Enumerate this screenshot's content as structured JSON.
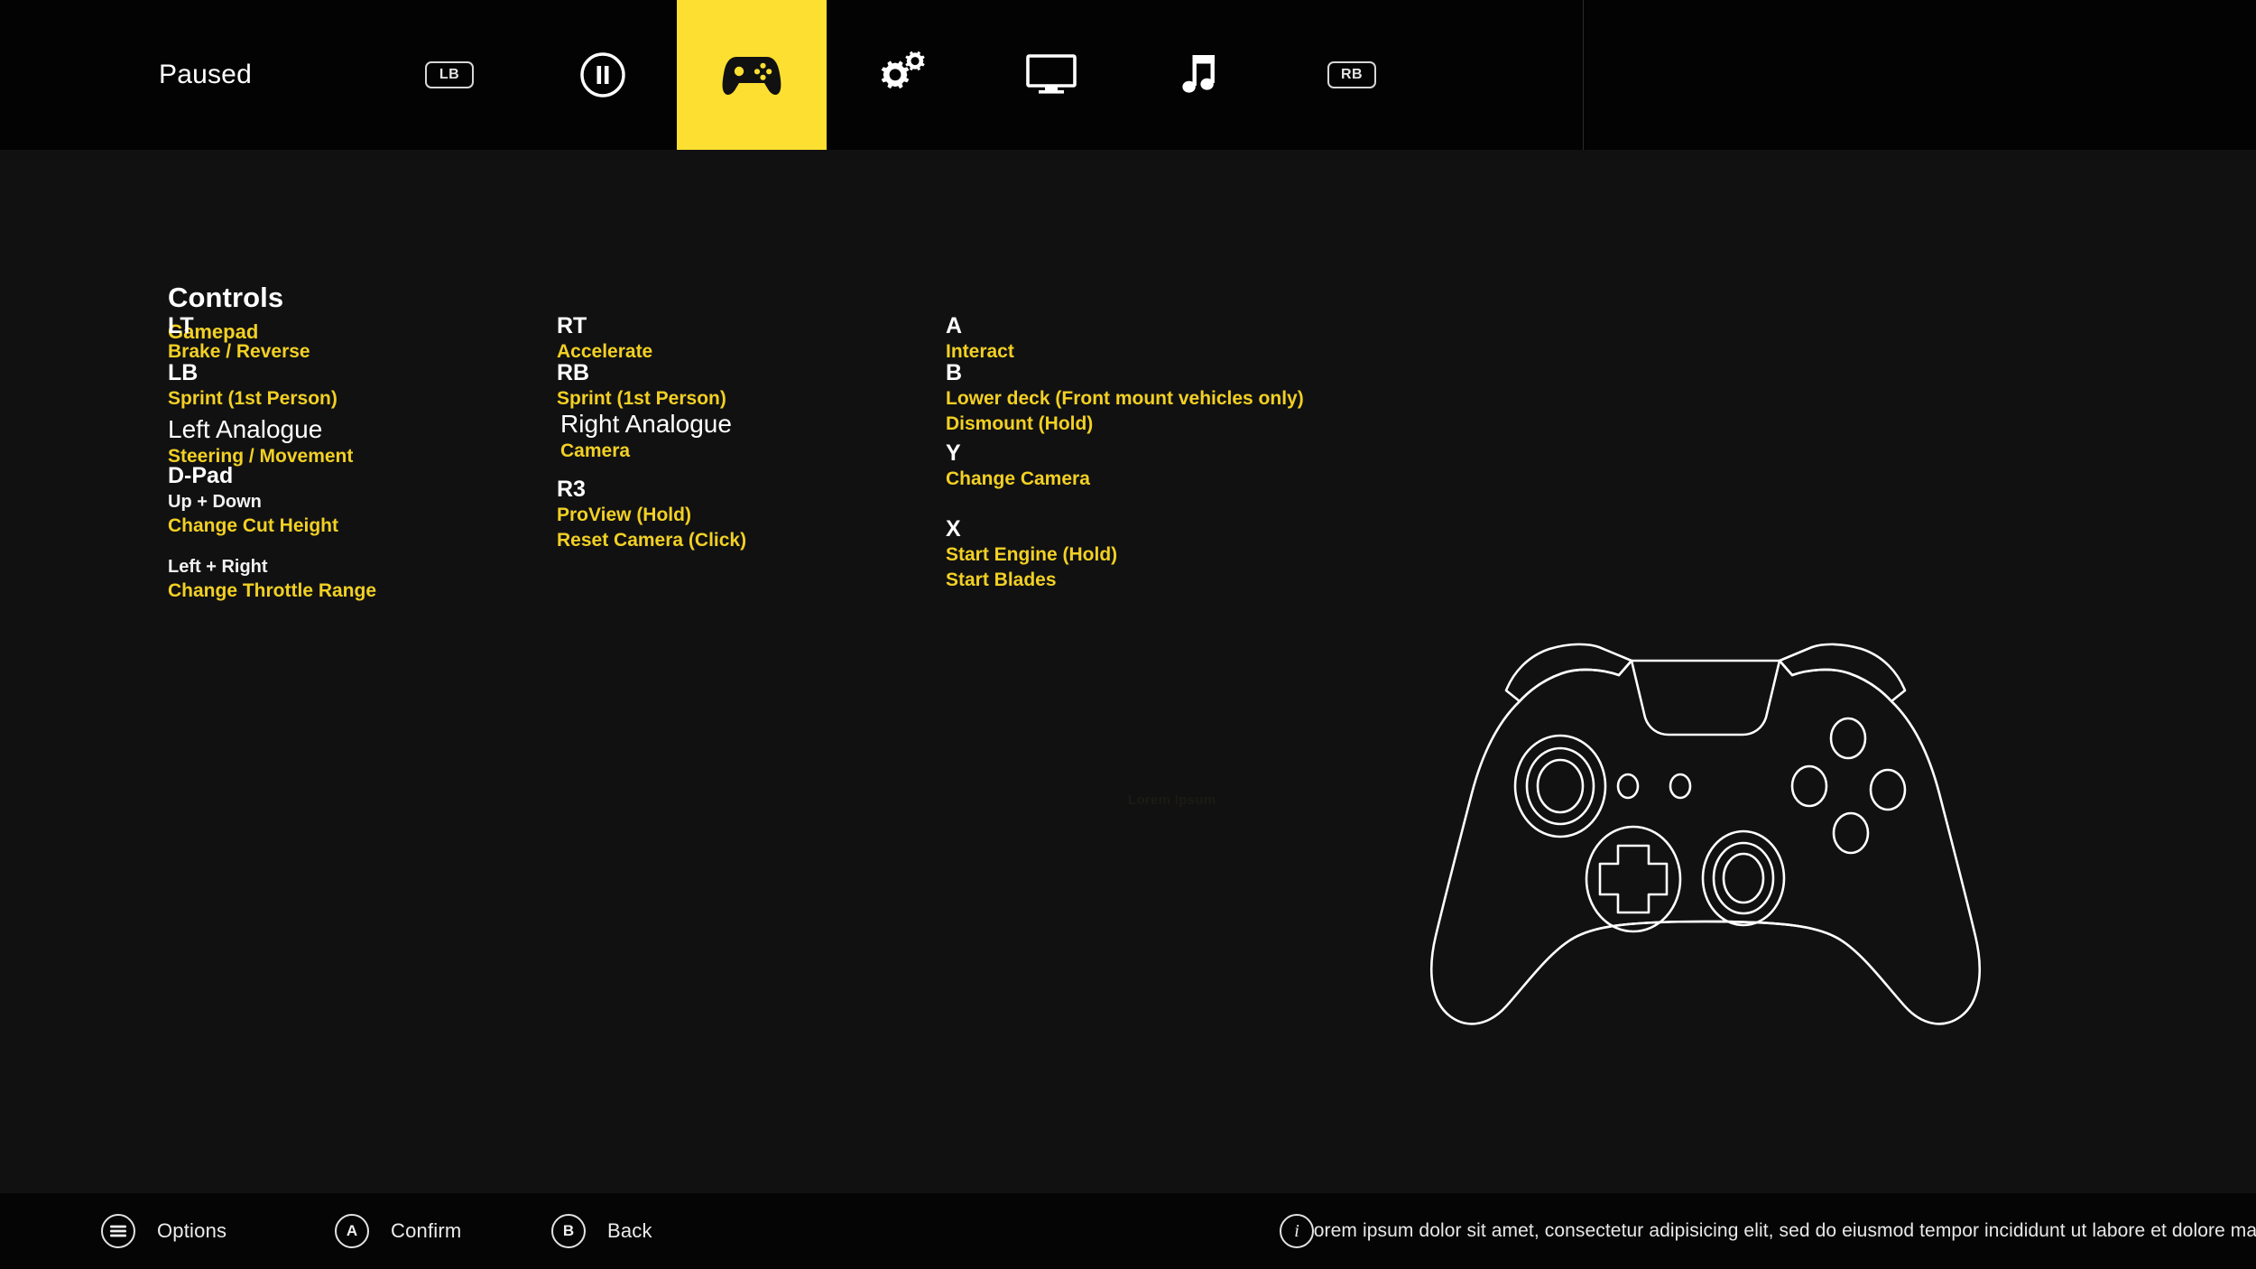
{
  "header": {
    "status_label": "Paused",
    "left_bumper_chip": "LB",
    "right_bumper_chip": "RB",
    "active_tab_color": "#FCDF31",
    "tabs": [
      {
        "id": "pause",
        "icon": "pause-circle-icon",
        "active": false
      },
      {
        "id": "controls",
        "icon": "gamepad-icon",
        "active": true
      },
      {
        "id": "settings",
        "icon": "gears-icon",
        "active": false
      },
      {
        "id": "display",
        "icon": "monitor-icon",
        "active": false
      },
      {
        "id": "audio",
        "icon": "music-note-icon",
        "active": false
      }
    ]
  },
  "main": {
    "title": "Controls",
    "subtitle": "Gamepad",
    "accent_color": "#F2D024",
    "watermark": "Lorem Ipsum",
    "columns": [
      {
        "bindings": [
          {
            "button": "LT",
            "big": false,
            "actions": [
              "Brake / Reverse"
            ]
          },
          {
            "button": "LB",
            "big": false,
            "actions": [
              "Sprint (1st Person)"
            ]
          },
          {
            "button": "Left Analogue",
            "big": true,
            "actions": [
              "Steering / Movement"
            ]
          },
          {
            "button": "D-Pad",
            "big": false,
            "groups": [
              {
                "direction": "Up + Down",
                "action": "Change Cut Height"
              },
              {
                "direction": "Left + Right",
                "action": "Change Throttle Range"
              }
            ]
          }
        ]
      },
      {
        "bindings": [
          {
            "button": "RT",
            "big": false,
            "actions": [
              "Accelerate"
            ]
          },
          {
            "button": "RB",
            "big": false,
            "actions": [
              "Sprint (1st Person)"
            ]
          },
          {
            "button": "Right Analogue",
            "big": true,
            "actions": [
              "Camera"
            ]
          },
          {
            "button": "R3",
            "big": false,
            "actions": [
              "ProView (Hold)",
              "Reset Camera (Click)"
            ]
          }
        ]
      },
      {
        "bindings": [
          {
            "button": "A",
            "big": false,
            "actions": [
              "Interact"
            ]
          },
          {
            "button": "B",
            "big": false,
            "actions": [
              "Lower deck (Front mount vehicles only)",
              "Dismount (Hold)"
            ]
          },
          {
            "button": "Y",
            "big": false,
            "actions": [
              "Change Camera"
            ]
          },
          {
            "button": "X",
            "big": false,
            "actions": [
              "Start Engine (Hold)",
              "Start Blades"
            ]
          }
        ]
      }
    ],
    "controller_illustration": "xbox-controller-outline"
  },
  "footer": {
    "actions": [
      {
        "glyph": "menu-icon",
        "label": "Options"
      },
      {
        "glyph": "A",
        "label": "Confirm"
      },
      {
        "glyph": "B",
        "label": "Back"
      }
    ],
    "info": {
      "glyph": "info-icon",
      "text": "Lorem ipsum dolor sit amet, consectetur adipisicing elit, sed do eiusmod tempor incididunt ut labore et dolore magna aliqua."
    }
  }
}
